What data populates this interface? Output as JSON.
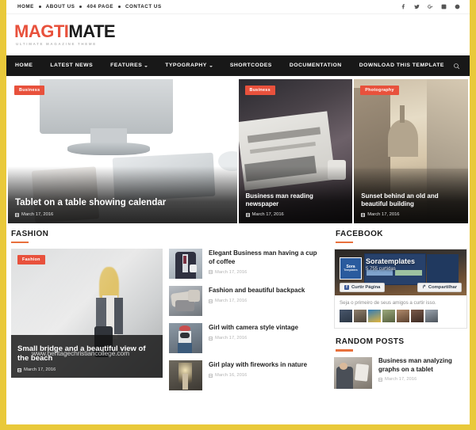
{
  "topbar": {
    "links": [
      "HOME",
      "ABOUT US",
      "404 PAGE",
      "CONTACT US"
    ],
    "social": [
      {
        "name": "facebook-icon",
        "glyph": "f"
      },
      {
        "name": "twitter-icon",
        "glyph": "t"
      },
      {
        "name": "googleplus-icon",
        "glyph": "G+"
      },
      {
        "name": "rss-icon",
        "glyph": "r"
      },
      {
        "name": "pinterest-icon",
        "glyph": "p"
      }
    ]
  },
  "brand": {
    "part1": "MAGTI",
    "part2": "MATE",
    "tagline": "ULTIMATE MAGAZINE THEME"
  },
  "mainnav": {
    "items": [
      {
        "label": "HOME",
        "caret": false
      },
      {
        "label": "LATEST NEWS",
        "caret": false
      },
      {
        "label": "FEATURES",
        "caret": true
      },
      {
        "label": "TYPOGRAPHY",
        "caret": true
      },
      {
        "label": "SHORTCODES",
        "caret": false
      },
      {
        "label": "DOCUMENTATION",
        "caret": false
      },
      {
        "label": "DOWNLOAD THIS TEMPLATE",
        "caret": false
      }
    ],
    "search_icon": "search-icon"
  },
  "features": [
    {
      "badge": "Business",
      "title": "Tablet on a table showing calendar",
      "date": "March 17, 2016"
    },
    {
      "badge": "Business",
      "title": "Business man reading newspaper",
      "date": "March 17, 2016"
    },
    {
      "badge": "Photography",
      "title": "Sunset behind an old and beautiful building",
      "date": "March 17, 2016"
    }
  ],
  "fashion": {
    "heading": "FASHION",
    "feature": {
      "badge": "Fashion",
      "title": "Small bridge and a beautiful view of the beach",
      "date": "March 17, 2016",
      "watermark": "www.heritagechristiancollege.com"
    },
    "posts": [
      {
        "title": "Elegant Business man having a cup of coffee",
        "date": "March 17, 2016"
      },
      {
        "title": "Fashion and beautiful backpack",
        "date": "March 17, 2016"
      },
      {
        "title": "Girl with camera style vintage",
        "date": "March 17, 2016"
      },
      {
        "title": "Girl play with fireworks in nature",
        "date": "March 16, 2016"
      }
    ]
  },
  "facebook": {
    "heading": "FACEBOOK",
    "page_name": "Soratemplates",
    "avatar_line1": "Sora",
    "avatar_line2": "Templates",
    "likes": "5.755 curtidas",
    "like_button": "Curtir Página",
    "share_button": "Compartilhar",
    "note": "Seja o primeiro de seus amigos a curtir isso."
  },
  "random": {
    "heading": "RANDOM POSTS",
    "posts": [
      {
        "title": "Business man analyzing graphs on a tablet",
        "date": "March 17, 2016"
      }
    ]
  },
  "colors": {
    "accent_yellow": "#e9c93a",
    "accent_red": "#e8513c",
    "accent_orange": "#e8703c",
    "nav_dark": "#181818"
  }
}
